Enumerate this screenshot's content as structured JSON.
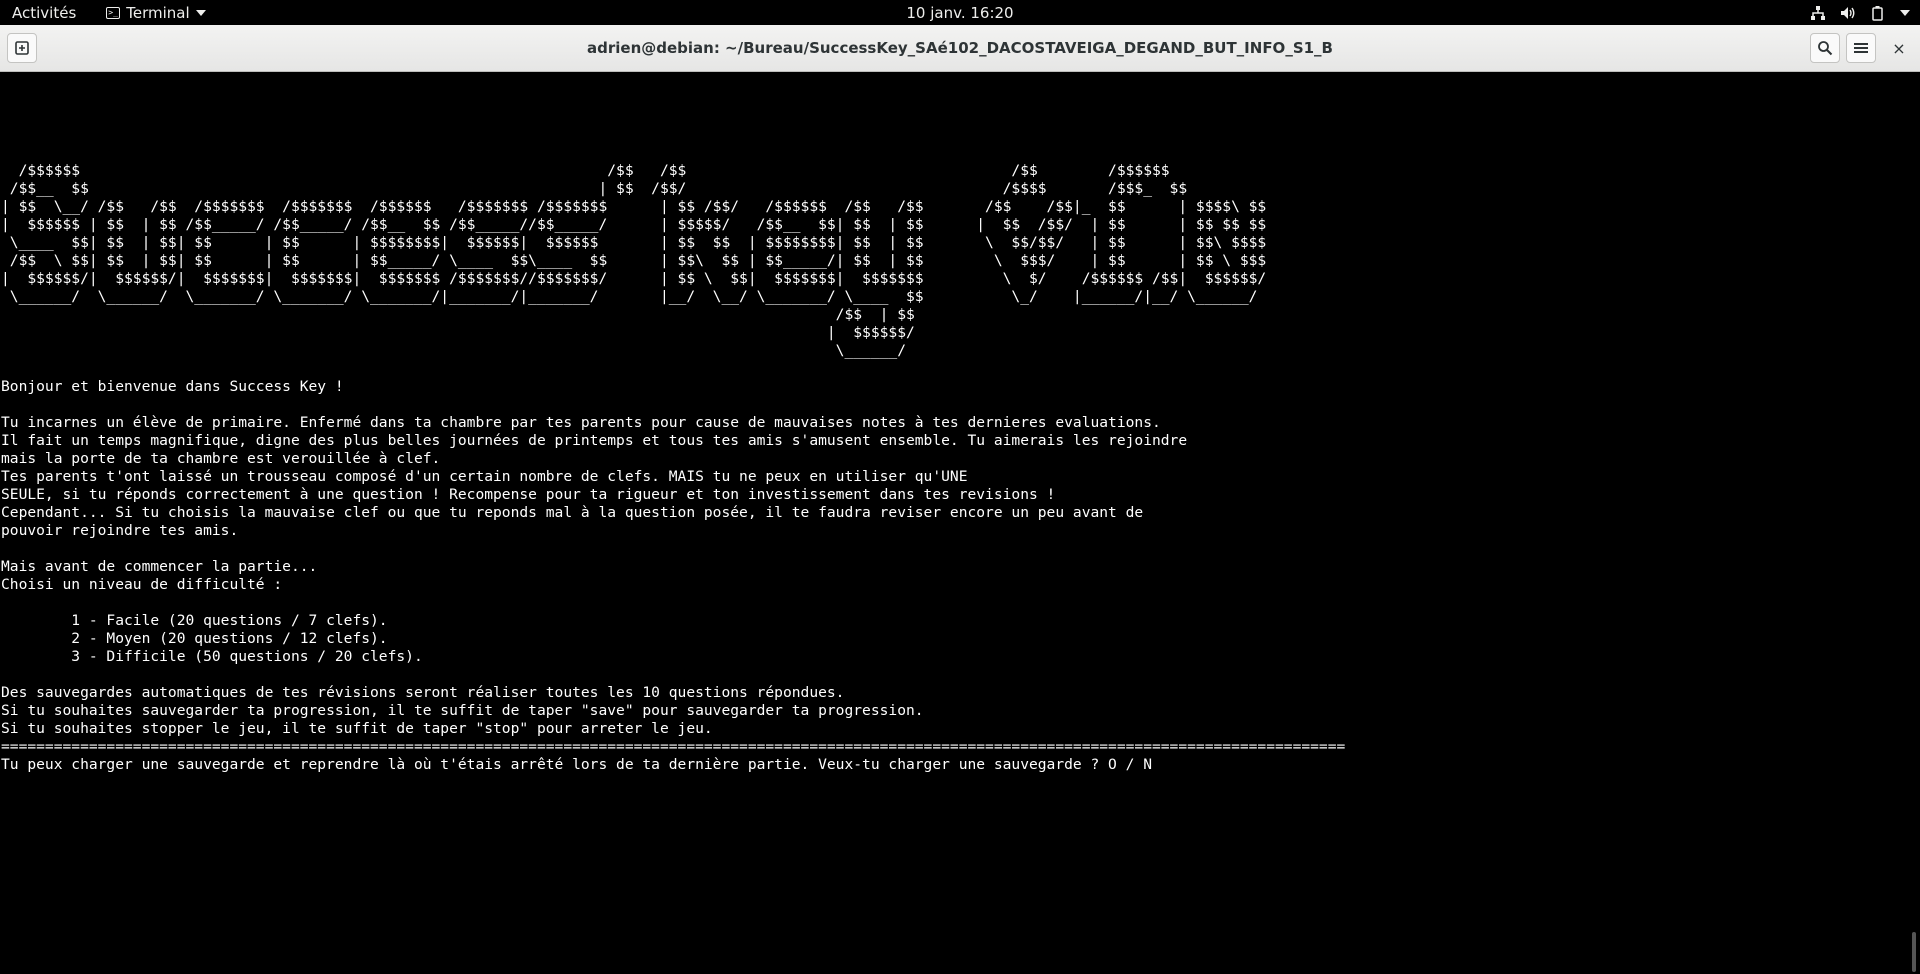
{
  "topbar": {
    "activities": "Activités",
    "app_name": "Terminal",
    "clock": "10 janv.  16:20"
  },
  "window": {
    "title": "adrien@debian: ~/Bureau/SuccessKey_SAé102_DACOSTAVEIGA_DEGAND_BUT_INFO_S1_B",
    "close_glyph": "×"
  },
  "terminal": {
    "output": "\n\n\n\n\n  /$$$$$$                                                            /$$   /$$                                     /$$        /$$$$$$\n /$$__  $$                                                          | $$  /$$/                                    /$$$$       /$$$_  $$\n| $$  \\__/ /$$   /$$  /$$$$$$$  /$$$$$$$  /$$$$$$   /$$$$$$$ /$$$$$$$      | $$ /$$/   /$$$$$$  /$$   /$$       /$$    /$$|_  $$      | $$$$\\ $$\n|  $$$$$$ | $$  | $$ /$$_____/ /$$_____/ /$$__  $$ /$$_____//$$_____/      | $$$$$/   /$$__  $$| $$  | $$      |  $$  /$$/  | $$      | $$ $$ $$\n \\____  $$| $$  | $$| $$      | $$      | $$$$$$$$|  $$$$$$|  $$$$$$       | $$  $$  | $$$$$$$$| $$  | $$       \\  $$/$$/   | $$      | $$\\ $$$$\n /$$  \\ $$| $$  | $$| $$      | $$      | $$_____/ \\____  $$\\____  $$      | $$\\  $$ | $$_____/| $$  | $$        \\  $$$/    | $$      | $$ \\ $$$\n|  $$$$$$/|  $$$$$$/|  $$$$$$$|  $$$$$$$|  $$$$$$$ /$$$$$$$//$$$$$$$/      | $$ \\  $$|  $$$$$$$|  $$$$$$$         \\  $/    /$$$$$$ /$$|  $$$$$$/\n \\______/  \\______/  \\_______/ \\_______/ \\_______/|_______/|_______/       |__/  \\__/ \\_______/ \\____  $$          \\_/    |______/|__/ \\______/\n                                                                                               /$$  | $$\n                                                                                              |  $$$$$$/\n                                                                                               \\______/\n\nBonjour et bienvenue dans Success Key !\n\nTu incarnes un élève de primaire. Enfermé dans ta chambre par tes parents pour cause de mauvaises notes à tes dernieres evaluations.\nIl fait un temps magnifique, digne des plus belles journées de printemps et tous tes amis s'amusent ensemble. Tu aimerais les rejoindre\nmais la porte de ta chambre est verouillée à clef.\nTes parents t'ont laissé un trousseau composé d'un certain nombre de clefs. MAIS tu ne peux en utiliser qu'UNE\nSEULE, si tu réponds correctement à une question ! Recompense pour ta rigueur et ton investissement dans tes revisions !\nCependant... Si tu choisis la mauvaise clef ou que tu reponds mal à la question posée, il te faudra reviser encore un peu avant de\npouvoir rejoindre tes amis.\n\nMais avant de commencer la partie...\nChoisi un niveau de difficulté :\n\n        1 - Facile (20 questions / 7 clefs).\n        2 - Moyen (20 questions / 12 clefs).\n        3 - Difficile (50 questions / 20 clefs).\n\nDes sauvegardes automatiques de tes révisions seront réaliser toutes les 10 questions répondues.\nSi tu souhaites sauvegarder ta progression, il te suffit de taper \"save\" pour sauvegarder ta progression.\nSi tu souhaites stopper le jeu, il te suffit de taper \"stop\" pour arreter le jeu.\n=========================================================================================================================================================\nTu peux charger une sauvegarde et reprendre là où t'étais arrêté lors de ta dernière partie. Veux-tu charger une sauvegarde ? O / N"
  }
}
